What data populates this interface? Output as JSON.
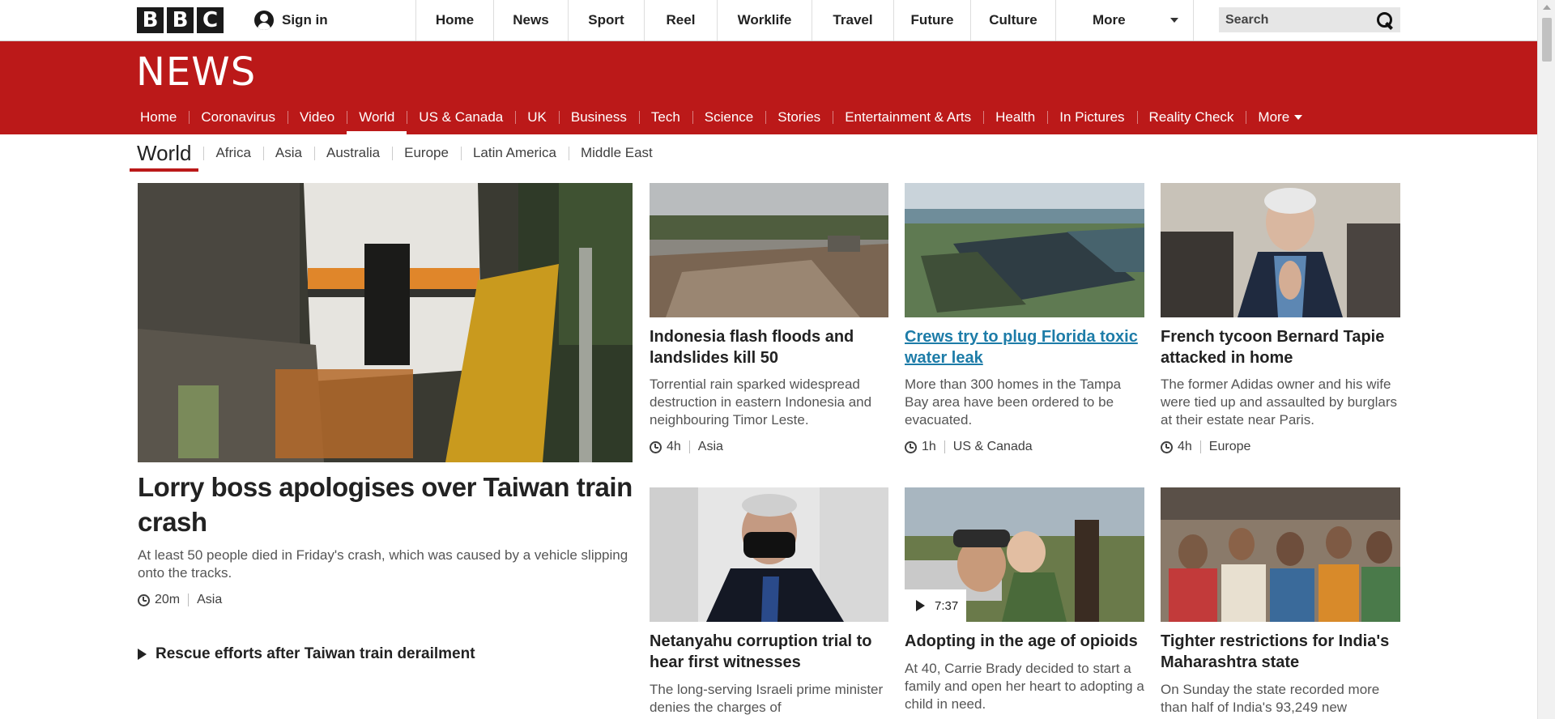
{
  "global_header": {
    "logo_letters": [
      "B",
      "B",
      "C"
    ],
    "sign_in": "Sign in",
    "nav": [
      {
        "label": "Home",
        "w": 97
      },
      {
        "label": "News",
        "w": 92
      },
      {
        "label": "Sport",
        "w": 94
      },
      {
        "label": "Reel",
        "w": 90
      },
      {
        "label": "Worklife",
        "w": 117
      },
      {
        "label": "Travel",
        "w": 101
      },
      {
        "label": "Future",
        "w": 95
      },
      {
        "label": "Culture",
        "w": 105
      }
    ],
    "more_label": "More",
    "search_placeholder": "Search"
  },
  "news_header": {
    "logo_text": "NEWS",
    "nav": [
      "Home",
      "Coronavirus",
      "Video",
      "World",
      "US & Canada",
      "UK",
      "Business",
      "Tech",
      "Science",
      "Stories",
      "Entertainment & Arts",
      "Health",
      "In Pictures",
      "Reality Check"
    ],
    "active": "World",
    "more_label": "More"
  },
  "subnav": {
    "section": "World",
    "items": [
      "Africa",
      "Asia",
      "Australia",
      "Europe",
      "Latin America",
      "Middle East"
    ]
  },
  "lead_story": {
    "headline": "Lorry boss apologises over Taiwan train crash",
    "summary": "At least 50 people died in Friday's crash, which was caused by a vehicle slipping onto the tracks.",
    "time": "20m",
    "section": "Asia",
    "related": "Rescue efforts after Taiwan train derailment"
  },
  "stories": [
    {
      "headline": "Indonesia flash floods and landslides kill 50",
      "summary": "Torrential rain sparked widespread destruction in eastern Indonesia and neighbouring Timor Leste.",
      "time": "4h",
      "section": "Asia"
    },
    {
      "headline": "Crews try to plug Florida toxic water leak",
      "summary": "More than 300 homes in the Tampa Bay area have been ordered to be evacuated.",
      "time": "1h",
      "section": "US & Canada"
    },
    {
      "headline": "French tycoon Bernard Tapie attacked in home",
      "summary": "The former Adidas owner and his wife were tied up and assaulted by burglars at their estate near Paris.",
      "time": "4h",
      "section": "Europe"
    },
    {
      "headline": "Netanyahu corruption trial to hear first witnesses",
      "summary": "The long-serving Israeli prime minister denies the charges of",
      "time": "",
      "section": ""
    },
    {
      "headline": "Adopting in the age of opioids",
      "summary": "At 40, Carrie Brady decided to start a family and open her heart to adopting a child in need.",
      "video_duration": "7:37",
      "time": "",
      "section": ""
    },
    {
      "headline": "Tighter restrictions for India's Maharashtra state",
      "summary": "On Sunday the state recorded more than half of India's 93,249 new",
      "time": "",
      "section": ""
    }
  ],
  "colors": {
    "brand_red": "#bb1919",
    "link_blue": "#1d7ca8"
  }
}
